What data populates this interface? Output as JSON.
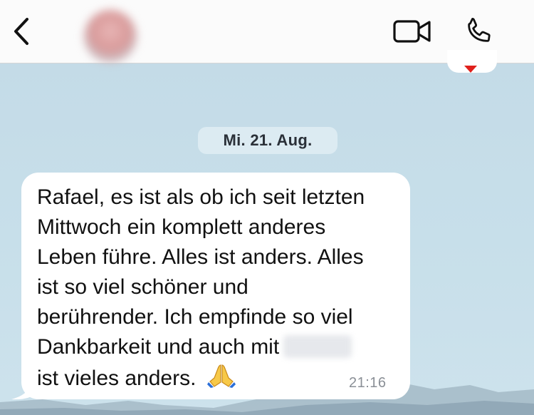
{
  "header": {
    "back_icon": "chevron-left-icon",
    "contact_name": "",
    "contact_status": "",
    "video_icon": "video-camera-icon",
    "call_icon": "phone-icon"
  },
  "chat": {
    "previous_reaction_icon": "heart-icon",
    "date_label": "Mi. 21. Aug.",
    "message": {
      "lines": [
        "Rafael, es ist als ob ich seit letzten",
        "Mittwoch ein komplett anderes",
        "Leben führe. Alles ist anders. Alles",
        "ist so viel schöner und",
        "berührender. Ich empfinde so viel",
        "Dankbarkeit und auch mit",
        "ist vieles anders."
      ],
      "emoji": "🙏",
      "time": "21:16"
    }
  },
  "colors": {
    "header_bg": "#fbfbfb",
    "wallpaper": "#c7dfea",
    "bubble": "#ffffff",
    "date_pill": "#dcebf2",
    "heart": "#e0201c"
  }
}
